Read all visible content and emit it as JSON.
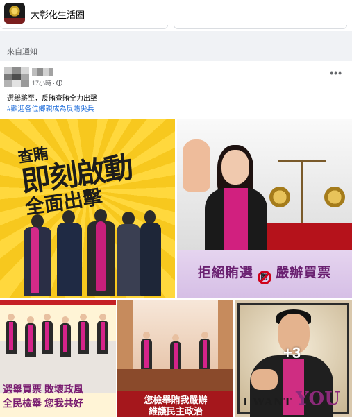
{
  "group": {
    "name": "大彰化生活圈"
  },
  "section": {
    "label": "來自通知"
  },
  "post": {
    "time": "17小時",
    "text": "選舉將至，反賄查賄全力出擊",
    "hashtag": "#歡迎各位鄉親成為反賄尖兵",
    "more_label": "•••"
  },
  "images": {
    "img1": {
      "line1": "查賄",
      "line2": "即刻啟動",
      "line3": "全面出擊"
    },
    "img2": {
      "text_before": "拒絕賄選",
      "icon_text": "賄",
      "text_after": "嚴辦買票"
    },
    "img3": {
      "row1": "選舉買票  敗壞政風",
      "row2": "全民檢舉  您我共好"
    },
    "img4": {
      "row1": "您檢舉賄我嚴辦",
      "row2": "維護民主政治"
    },
    "img5": {
      "want": "I WANT",
      "you": "YOU",
      "more_count": "+3"
    }
  },
  "colors": {
    "link": "#216fdb",
    "muted": "#65676b",
    "feed_bg": "#f0f2f5"
  }
}
